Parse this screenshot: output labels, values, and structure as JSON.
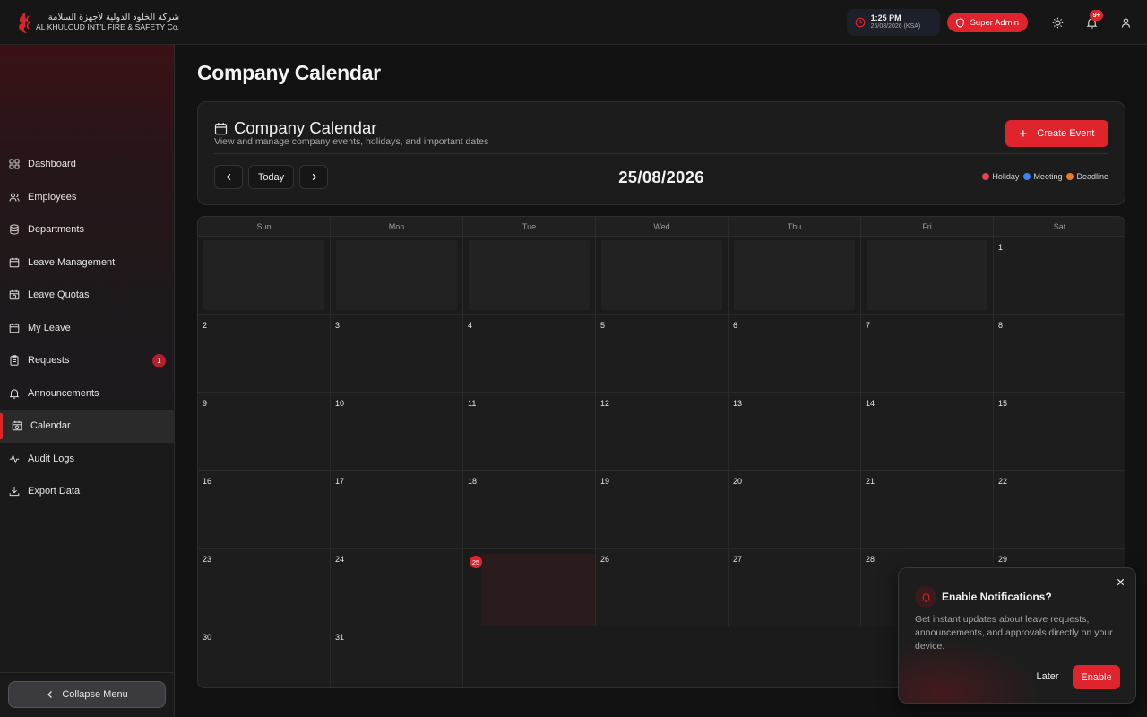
{
  "brand": {
    "name_ar": "شركة الخلود الدولية لأجهزة السلامة",
    "name_en": "AL KHULOUD INT'L FIRE & SAFETY Co.",
    "accent_color": "#e0242e"
  },
  "topbar": {
    "time": "1:25 PM",
    "date": "25/08/2026 (KSA)",
    "role": "Super Admin",
    "notification_count": "9+"
  },
  "sidebar": {
    "items": [
      {
        "label": "Dashboard",
        "icon": "grid-icon"
      },
      {
        "label": "Employees",
        "icon": "users-icon"
      },
      {
        "label": "Departments",
        "icon": "database-icon"
      },
      {
        "label": "Leave Management",
        "icon": "calendar-icon"
      },
      {
        "label": "Leave Quotas",
        "icon": "calendar-clock-icon"
      },
      {
        "label": "My Leave",
        "icon": "calendar-icon"
      },
      {
        "label": "Requests",
        "icon": "clipboard-icon",
        "badge": "1"
      },
      {
        "label": "Announcements",
        "icon": "bell-icon"
      },
      {
        "label": "Calendar",
        "icon": "calendar-clock-icon",
        "active": true
      },
      {
        "label": "Audit Logs",
        "icon": "activity-icon"
      },
      {
        "label": "Export Data",
        "icon": "download-icon"
      }
    ],
    "collapse_label": "Collapse Menu"
  },
  "page": {
    "title": "Company Calendar"
  },
  "calendar": {
    "title": "Company Calendar",
    "subtitle": "View and manage company events, holidays, and important dates",
    "create_label": "Create Event",
    "today_label": "Today",
    "current_date": "25/08/2026",
    "legend": [
      {
        "label": "Holiday",
        "color": "#e8434b"
      },
      {
        "label": "Meeting",
        "color": "#3b82f6"
      },
      {
        "label": "Deadline",
        "color": "#f07a22"
      }
    ],
    "weekdays": [
      "Sun",
      "Mon",
      "Tue",
      "Wed",
      "Thu",
      "Fri",
      "Sat"
    ],
    "days": [
      "",
      "",
      "",
      "",
      "",
      "",
      "1",
      "2",
      "3",
      "4",
      "5",
      "6",
      "7",
      "8",
      "9",
      "10",
      "11",
      "12",
      "13",
      "14",
      "15",
      "16",
      "17",
      "18",
      "19",
      "20",
      "21",
      "22",
      "23",
      "24",
      "25",
      "26",
      "27",
      "28",
      "29",
      "30",
      "31"
    ],
    "today": "25"
  },
  "notification_prompt": {
    "title": "Enable Notifications?",
    "body": "Get instant updates about leave requests, announcements, and approvals directly on your device.",
    "later_label": "Later",
    "enable_label": "Enable"
  }
}
